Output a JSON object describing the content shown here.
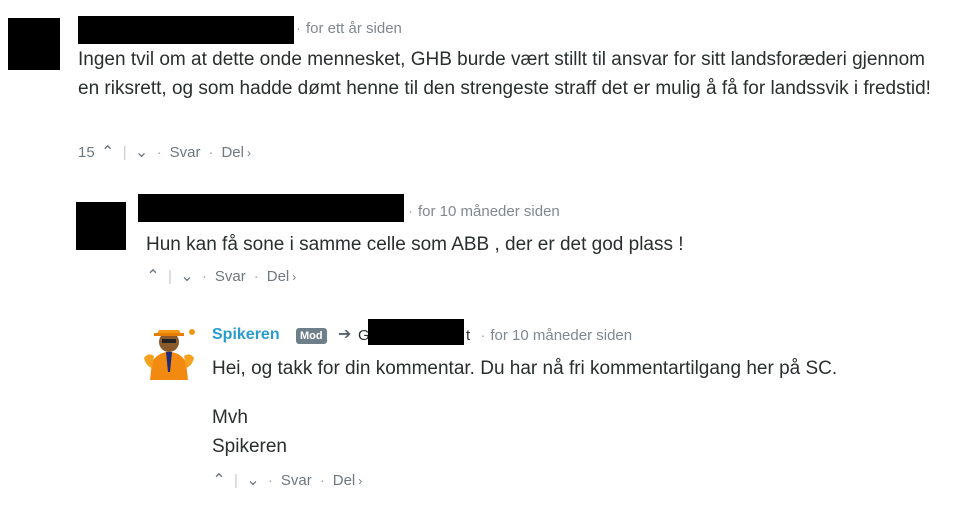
{
  "comments": [
    {
      "timestamp": "for ett år siden",
      "text": "Ingen tvil om at dette onde mennesket, GHB burde vært stillt til ansvar for sitt landsforæderi gjennom en riksrett, og som hadde dømt henne til den strengeste straff det er mulig å få for landssvik i fredstid!",
      "votes": "15",
      "reply_label": "Svar",
      "share_label": "Del"
    },
    {
      "timestamp": "for 10 måneder siden",
      "text": "Hun kan få sone i samme celle som ABB , der er det god plass !",
      "reply_label": "Svar",
      "share_label": "Del"
    },
    {
      "author": "Spikeren",
      "badge": "Mod",
      "reply_to_partial": "G",
      "reply_to_suffix": "t",
      "timestamp": "for 10 måneder siden",
      "text_line1": "Hei, og takk for din kommentar. Du har nå fri kommentartilgang her på SC.",
      "text_line2": "Mvh",
      "text_line3": "Spikeren",
      "reply_label": "Svar",
      "share_label": "Del"
    }
  ],
  "icons": {
    "upvote": "chevron-up",
    "downvote": "chevron-down",
    "reply_to": "arrow-right",
    "share": "chevron-right"
  }
}
